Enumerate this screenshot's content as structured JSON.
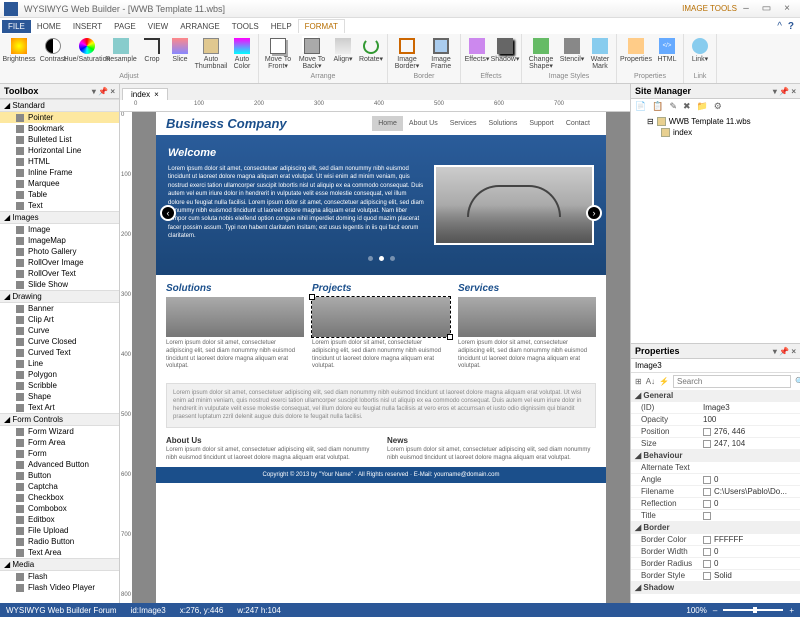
{
  "window": {
    "app_title": "WYSIWYG Web Builder - [WWB Template 11.wbs]",
    "context_tab": "IMAGE TOOLS",
    "min": "–",
    "max": "▭",
    "close": "×"
  },
  "menu": {
    "tabs": [
      "FILE",
      "HOME",
      "INSERT",
      "PAGE",
      "VIEW",
      "ARRANGE",
      "TOOLS",
      "HELP",
      "FORMAT"
    ],
    "active": "FORMAT"
  },
  "ribbon": {
    "groups": [
      {
        "name": "Adjust",
        "items": [
          "Brightness",
          "Contrast",
          "Hue/Saturation",
          "Resample",
          "Crop",
          "Slice",
          "Auto Thumbnail",
          "Auto Color"
        ]
      },
      {
        "name": "Arrange",
        "items": [
          "Move To Front▾",
          "Move To Back▾",
          "Align▾",
          "Rotate▾"
        ]
      },
      {
        "name": "Border",
        "items": [
          "Image Border▾",
          "Image Frame"
        ]
      },
      {
        "name": "Effects",
        "items": [
          "Effects▾",
          "Shadow▾"
        ]
      },
      {
        "name": "Image Styles",
        "items": [
          "Change Shape▾",
          "Stencil▾",
          "Water Mark"
        ]
      },
      {
        "name": "Properties",
        "items": [
          "Properties",
          "HTML"
        ]
      },
      {
        "name": "Link",
        "items": [
          "Link▾"
        ]
      }
    ]
  },
  "toolbox": {
    "title": "Toolbox",
    "categories": [
      {
        "name": "Standard",
        "items": [
          "Pointer",
          "Bookmark",
          "Bulleted List",
          "Horizontal Line",
          "HTML",
          "Inline Frame",
          "Marquee",
          "Table",
          "Text"
        ]
      },
      {
        "name": "Images",
        "items": [
          "Image",
          "ImageMap",
          "Photo Gallery",
          "RollOver Image",
          "RollOver Text",
          "Slide Show"
        ]
      },
      {
        "name": "Drawing",
        "items": [
          "Banner",
          "Clip Art",
          "Curve",
          "Curve Closed",
          "Curved Text",
          "Line",
          "Polygon",
          "Scribble",
          "Shape",
          "Text Art"
        ]
      },
      {
        "name": "Form Controls",
        "items": [
          "Form Wizard",
          "Form Area",
          "Form",
          "Advanced Button",
          "Button",
          "Captcha",
          "Checkbox",
          "Combobox",
          "Editbox",
          "File Upload",
          "Radio Button",
          "Text Area"
        ]
      },
      {
        "name": "Media",
        "items": [
          "Flash",
          "Flash Video Player"
        ]
      }
    ],
    "selected": "Pointer"
  },
  "doc": {
    "tab_name": "index",
    "close": "×"
  },
  "ruler_h": [
    "0",
    "100",
    "200",
    "300",
    "400",
    "500",
    "600",
    "700"
  ],
  "ruler_v": [
    "0",
    "100",
    "200",
    "300",
    "400",
    "500",
    "600",
    "700",
    "800"
  ],
  "page": {
    "logo": "Business Company",
    "nav": [
      "Home",
      "About Us",
      "Services",
      "Solutions",
      "Support",
      "Contact"
    ],
    "nav_active": "Home",
    "hero_title": "Welcome",
    "hero_text": "Lorem ipsum dolor sit amet, consectetuer adipiscing elit, sed diam nonummy nibh euismod tincidunt ut laoreet dolore magna aliquam erat volutpat. Ut wisi enim ad minim veniam, quis nostrud exerci tation ullamcorper suscipit lobortis nisl ut aliquip ex ea commodo consequat. Duis autem vel eum iriure dolor in hendrerit in vulputate velit esse molestie consequat, vel illum dolore eu feugiat nulla facilisi. Lorem ipsum dolor sit amet, consectetuer adipiscing elit, sed diam nonummy nibh euismod tincidunt ut laoreet dolore magna aliquam erat volutpat. Nam liber tempor cum soluta nobis eleifend option congue nihil imperdiet doming id quod mazim placerat facer possim assum. Typi non habent claritatem insitam; est usus legentis in iis qui facit eorum claritatem.",
    "cols": [
      {
        "title": "Solutions",
        "text": "Lorem ipsum dolor sit amet, consectetuer adipiscing elit, sed diam nonummy nibh euismod tincidunt ut laoreet dolore magna aliquam erat volutpat."
      },
      {
        "title": "Projects",
        "text": "Lorem ipsum dolor sit amet, consectetuer adipiscing elit, sed diam nonummy nibh euismod tincidunt ut laoreet dolore magna aliquam erat volutpat."
      },
      {
        "title": "Services",
        "text": "Lorem ipsum dolor sit amet, consectetuer adipiscing elit, sed diam nonummy nibh euismod tincidunt ut laoreet dolore magna aliquam erat volutpat."
      }
    ],
    "graybox": "Lorem ipsum dolor sit amet, consectetuer adipiscing elit, sed diam nonummy nibh euismod tincidunt ut laoreet dolore magna aliquam erat volutpat. Ut wisi enim ad minim veniam, quis nostrud exerci tation ullamcorper suscipit lobortis nisl ut aliquip ex ea commodo consequat. Duis autem vel eum iriure dolor in hendrerit in vulputate velit esse molestie consequat, vel illum dolore eu feugiat nulla facilisis at vero eros et accumsan et iusto odio dignissim qui blandit praesent luptatum zzril delenit augue duis dolore te feugait nulla facilisi.",
    "about_h": "About Us",
    "about_t": "Lorem ipsum dolor sit amet, consectetuer adipiscing elit, sed diam nonummy nibh euismod tincidunt ut laoreet dolore magna aliquam erat volutpat.",
    "news_h": "News",
    "news_t": "Lorem ipsum dolor sit amet, consectetuer adipiscing elit, sed diam nonummy nibh euismod tincidunt ut laoreet dolore magna aliquam erat volutpat.",
    "footer": "Copyright © 2013 by \"Your Name\"  ·  All Rights reserved  ·  E-Mail: yourname@domain.com"
  },
  "sitemgr": {
    "title": "Site Manager",
    "root": "WWB Template 11.wbs",
    "pages": [
      "index"
    ]
  },
  "props": {
    "title": "Properties",
    "object": "Image3",
    "search_ph": "Search",
    "rows": [
      {
        "cat": "General"
      },
      {
        "k": "(ID)",
        "v": "Image3"
      },
      {
        "k": "Opacity",
        "v": "100"
      },
      {
        "k": "Position",
        "v": "276, 446",
        "chk": true
      },
      {
        "k": "Size",
        "v": "247, 104",
        "chk": true
      },
      {
        "cat": "Behaviour"
      },
      {
        "k": "Alternate Text",
        "v": ""
      },
      {
        "k": "Angle",
        "v": "0",
        "chk": true
      },
      {
        "k": "Filename",
        "v": "C:\\Users\\Pablo\\Do...",
        "chk": true
      },
      {
        "k": "Reflection",
        "v": "0",
        "chk": true
      },
      {
        "k": "Title",
        "v": "",
        "chk": true
      },
      {
        "cat": "Border"
      },
      {
        "k": "Border Color",
        "v": "FFFFFF",
        "chk": true
      },
      {
        "k": "Border Width",
        "v": "0",
        "chk": true
      },
      {
        "k": "Border Radius",
        "v": "0",
        "chk": true
      },
      {
        "k": "Border Style",
        "v": "Solid",
        "chk": true
      },
      {
        "cat": "Shadow"
      }
    ]
  },
  "status": {
    "forum": "WYSIWYG Web Builder Forum",
    "id": "id:Image3",
    "xy": "x:276, y:446",
    "wh": "w:247 h:104",
    "zoom": "100%"
  }
}
